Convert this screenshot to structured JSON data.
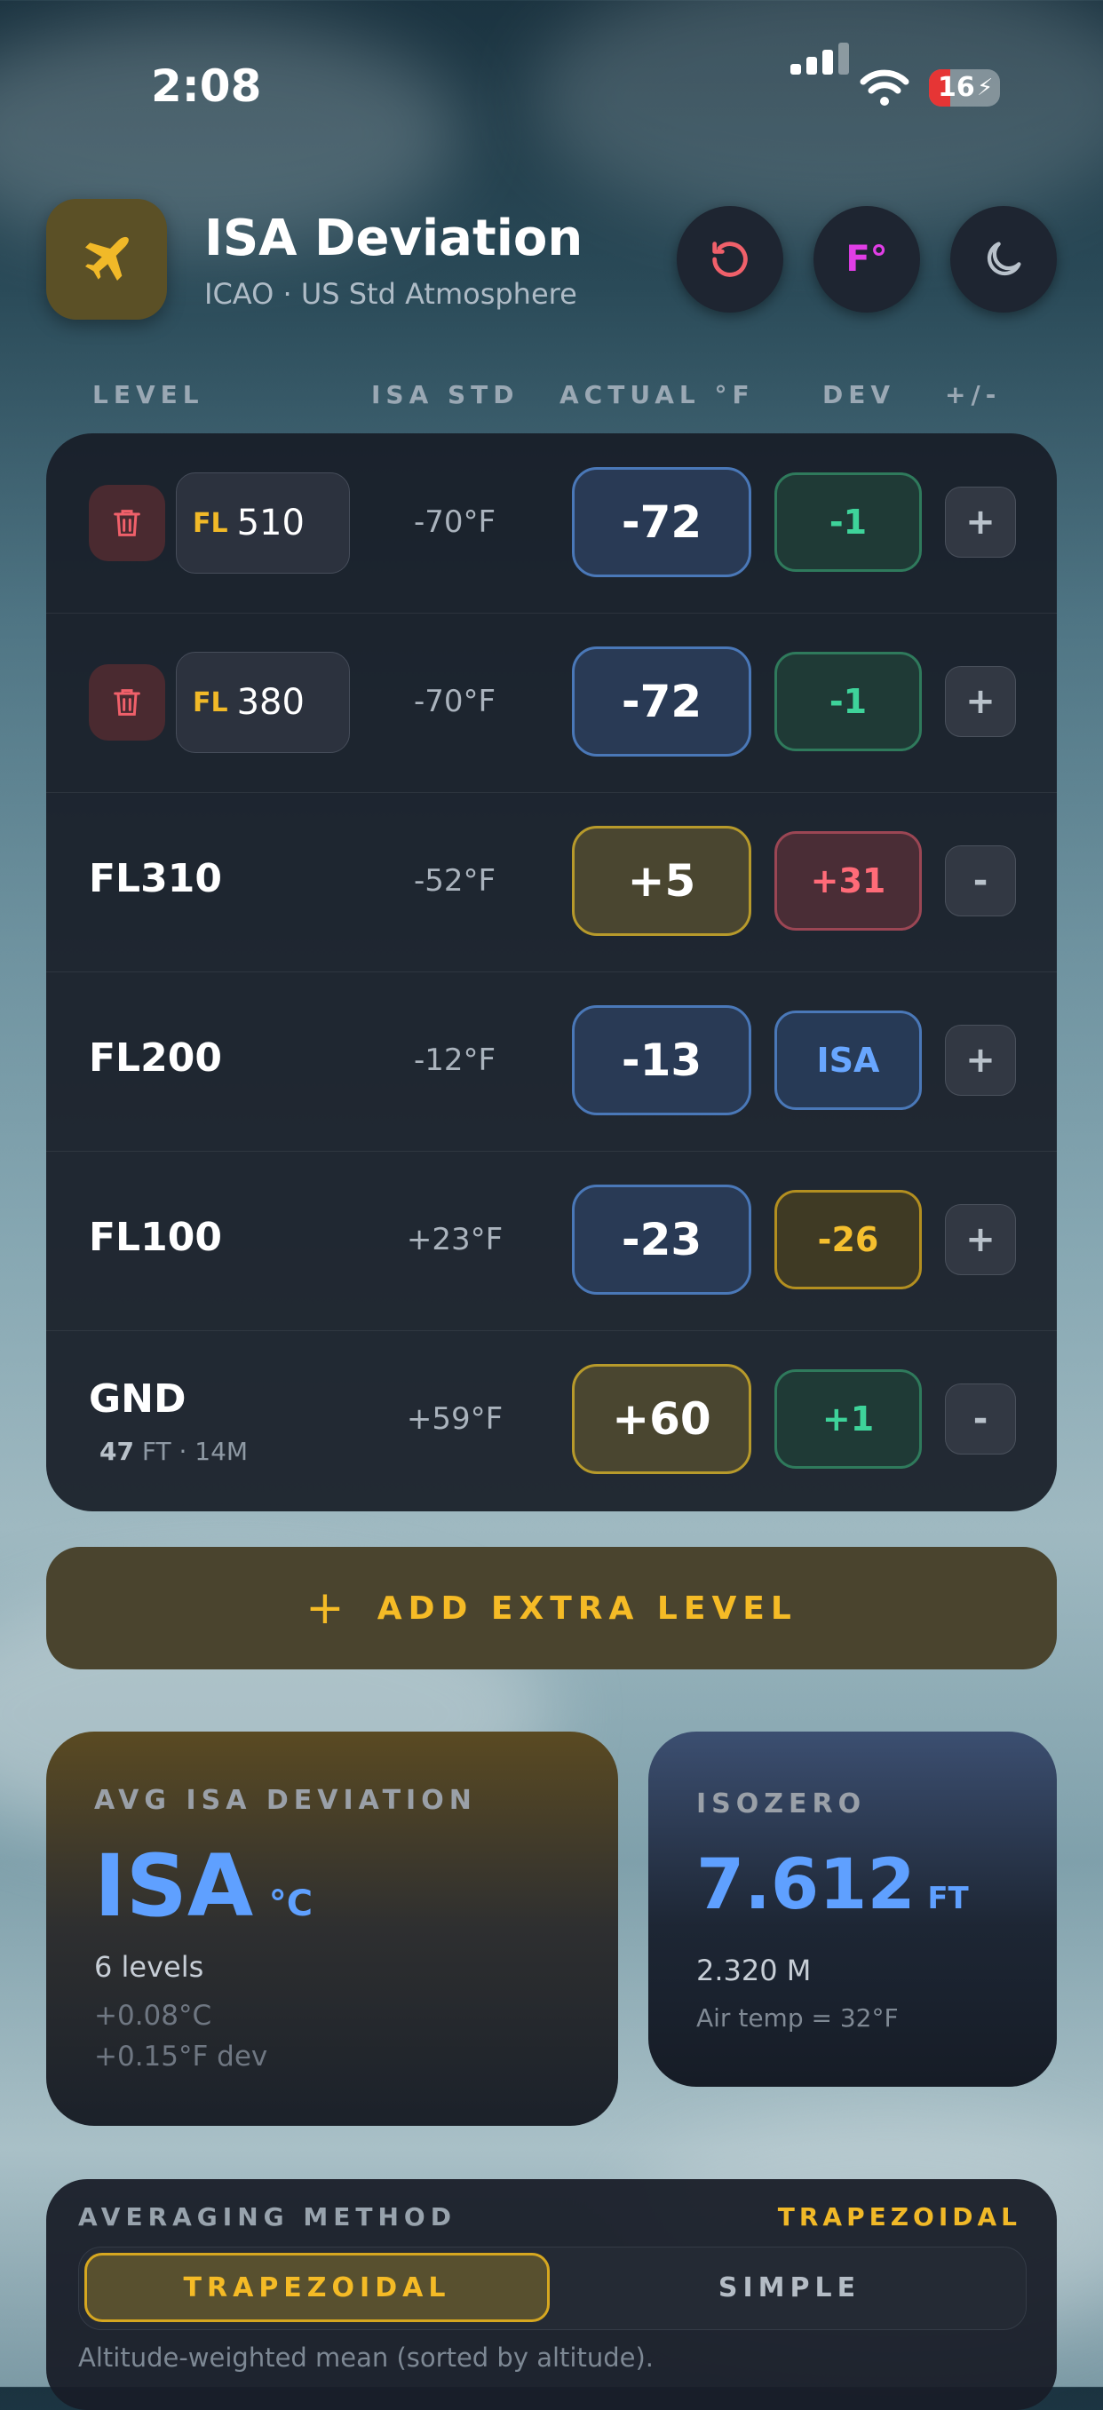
{
  "status_bar": {
    "time": "2:08",
    "battery": "16"
  },
  "header": {
    "title": "ISA Deviation",
    "subtitle": "ICAO · US Std Atmosphere",
    "unit_button": "F°"
  },
  "columns": {
    "level": "LEVEL",
    "isa_std": "ISA STD",
    "actual": "ACTUAL °F",
    "dev": "DEV",
    "pm": "+/-"
  },
  "rows": [
    {
      "editable": true,
      "fl_prefix": "FL",
      "fl_value": "510",
      "isa": "-70°F",
      "actual": "-72",
      "actual_style": "blue",
      "dev": "-1",
      "dev_style": "green",
      "pm": "+"
    },
    {
      "editable": true,
      "fl_prefix": "FL",
      "fl_value": "380",
      "isa": "-70°F",
      "actual": "-72",
      "actual_style": "blue",
      "dev": "-1",
      "dev_style": "green",
      "pm": "+"
    },
    {
      "name": "FL310",
      "isa": "-52°F",
      "actual": "+5",
      "actual_style": "gold",
      "dev": "+31",
      "dev_style": "red",
      "pm": "-"
    },
    {
      "name": "FL200",
      "isa": "-12°F",
      "actual": "-13",
      "actual_style": "blue",
      "dev": "ISA",
      "dev_style": "blue",
      "pm": "+"
    },
    {
      "name": "FL100",
      "isa": "+23°F",
      "actual": "-23",
      "actual_style": "blue",
      "dev": "-26",
      "dev_style": "gold",
      "pm": "+"
    },
    {
      "name": "GND",
      "sub_value": "47",
      "sub_unit": "FT",
      "sub_extra": "· 14M",
      "isa": "+59°F",
      "actual": "+60",
      "actual_style": "gold",
      "dev": "+1",
      "dev_style": "green",
      "pm": "-"
    }
  ],
  "add_button": {
    "icon": "plus-icon",
    "label": "ADD EXTRA LEVEL"
  },
  "avg_card": {
    "label": "AVG ISA DEVIATION",
    "value": "ISA",
    "unit": "°C",
    "levels": "6 levels",
    "line1": "+0.08°C",
    "line2": "+0.15°F dev"
  },
  "isozero_card": {
    "label": "ISOZERO",
    "value": "7.612",
    "unit": "FT",
    "meters": "2.320 M",
    "note": "Air temp = 32°F"
  },
  "averaging": {
    "label": "AVERAGING METHOD",
    "current": "TRAPEZOIDAL",
    "options": [
      "TRAPEZOIDAL",
      "SIMPLE"
    ],
    "hint": "Altitude-weighted mean (sorted by altitude)."
  },
  "colors": {
    "accent": "#f5bb26",
    "blue": "#5fa0ff",
    "green": "#3ed39a",
    "red": "#ff6b78",
    "magenta": "#e13ee6"
  }
}
